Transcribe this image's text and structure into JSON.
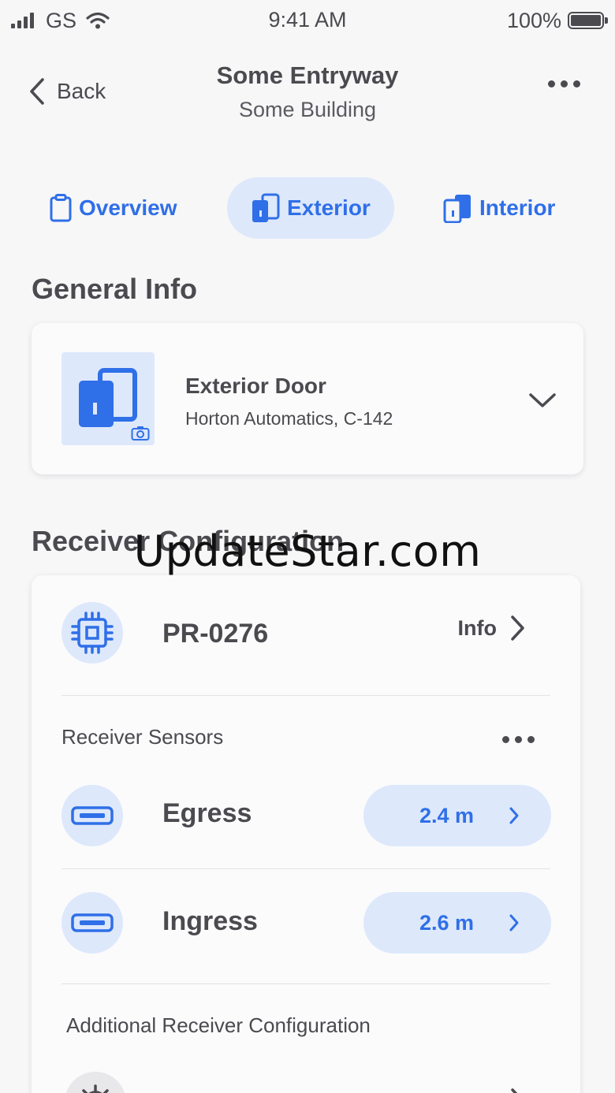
{
  "status_bar": {
    "carrier": "GS",
    "time": "9:41 AM",
    "battery": "100%"
  },
  "header": {
    "back_label": "Back",
    "title": "Some Entryway",
    "subtitle": "Some Building"
  },
  "tabs": [
    {
      "label": "Overview",
      "icon": "clipboard-icon",
      "active": false
    },
    {
      "label": "Exterior",
      "icon": "door-icon",
      "active": true
    },
    {
      "label": "Interior",
      "icon": "door-icon",
      "active": false
    }
  ],
  "general_info": {
    "section_title": "General Info",
    "door_name": "Exterior Door",
    "door_model": "Horton Automatics, C-142"
  },
  "receiver": {
    "section_title": "Receiver Configuration",
    "id": "PR-0276",
    "info_label": "Info",
    "sensors_heading": "Receiver Sensors",
    "sensors": [
      {
        "label": "Egress",
        "value": "2.4 m"
      },
      {
        "label": "Ingress",
        "value": "2.6 m"
      }
    ],
    "additional_heading": "Additional Receiver Configuration"
  },
  "watermark": "UpdateStar.com",
  "colors": {
    "accent": "#2f6fe8",
    "accent_light": "#dde8fb",
    "text": "#4a4a4f",
    "background": "#f7f7f8"
  }
}
